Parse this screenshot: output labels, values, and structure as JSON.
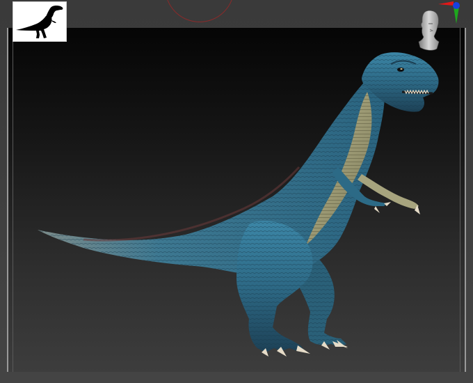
{
  "tool_thumbnail": {
    "icon": "t-rex-silhouette-icon",
    "background": "#ffffff"
  },
  "navigation": {
    "head_icon": "navigation-head-icon",
    "axis_icon": "axis-gizmo-icon",
    "axis_colors": {
      "x": "#e01818",
      "y": "#1ea81e",
      "z": "#1840e0"
    }
  },
  "canvas": {
    "model_icon": "t-rex-sculpt-model",
    "colors": {
      "skin_blue": "#2f6f8c",
      "skin_dark": "#1b3e52",
      "belly": "#a7a47e",
      "claw": "#e6dcc8"
    }
  },
  "brush_cursor": {
    "icon": "brush-ring-icon",
    "color": "#8a2a2a"
  }
}
